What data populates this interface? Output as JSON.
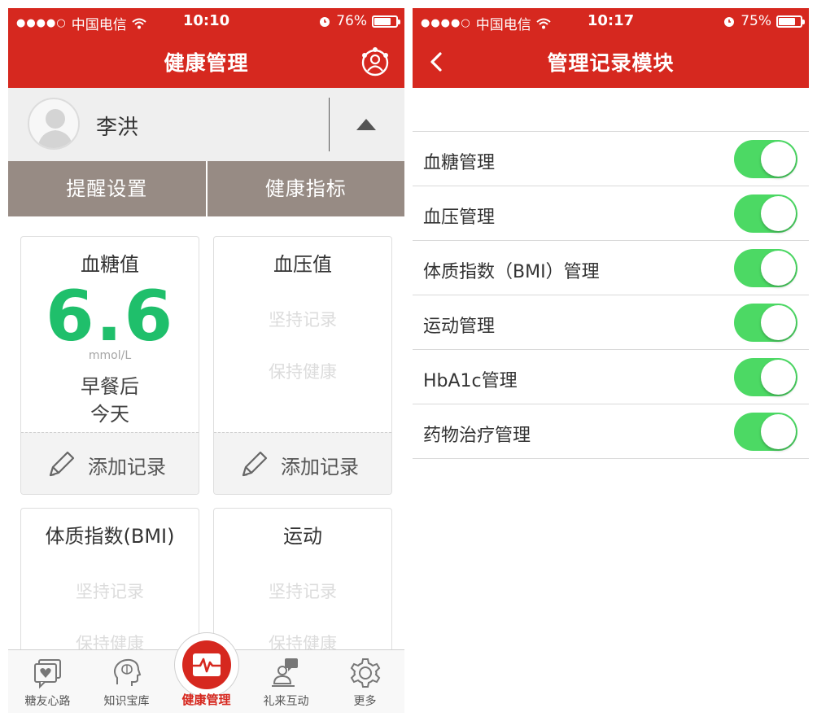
{
  "colors": {
    "accent": "#d6281f",
    "tab_bg": "#978b84",
    "value_green": "#1fbf6b",
    "toggle_on": "#4cd964"
  },
  "left": {
    "status": {
      "dots": "●●●●○",
      "carrier": "中国电信",
      "time": "10:10",
      "battery_text": "76%",
      "battery_level": 76
    },
    "nav": {
      "title": "健康管理",
      "right_icon": "user-settings-icon"
    },
    "user": {
      "name": "李洪"
    },
    "tabs": [
      "提醒设置",
      "健康指标"
    ],
    "cards": {
      "glucose": {
        "title": "血糖值",
        "value": "6.6",
        "unit": "mmol/L",
        "meal": "早餐后",
        "day": "今天",
        "add": "添加记录"
      },
      "pressure": {
        "title": "血压值",
        "hint1": "坚持记录",
        "hint2": "保持健康",
        "add": "添加记录"
      },
      "bmi": {
        "title": "体质指数(BMI)",
        "hint1": "坚持记录",
        "hint2": "保持健康"
      },
      "exercise": {
        "title": "运动",
        "hint1": "坚持记录",
        "hint2": "保持健康"
      }
    },
    "bottom_nav": [
      {
        "label": "糖友心路",
        "icon": "heart-chat-icon"
      },
      {
        "label": "知识宝库",
        "icon": "brain-head-icon"
      },
      {
        "label": "健康管理",
        "icon": "heartbeat-icon"
      },
      {
        "label": "礼来互动",
        "icon": "interaction-icon"
      },
      {
        "label": "更多",
        "icon": "gear-icon"
      }
    ]
  },
  "right": {
    "status": {
      "dots": "●●●●○",
      "carrier": "中国电信",
      "time": "10:17",
      "battery_text": "75%",
      "battery_level": 75
    },
    "nav": {
      "title": "管理记录模块",
      "left_icon": "back-chevron-icon"
    },
    "modules": [
      {
        "label": "血糖管理",
        "on": true
      },
      {
        "label": "血压管理",
        "on": true
      },
      {
        "label": "体质指数（BMI）管理",
        "on": true
      },
      {
        "label": "运动管理",
        "on": true
      },
      {
        "label": "HbA1c管理",
        "on": true
      },
      {
        "label": "药物治疗管理",
        "on": true
      }
    ]
  }
}
